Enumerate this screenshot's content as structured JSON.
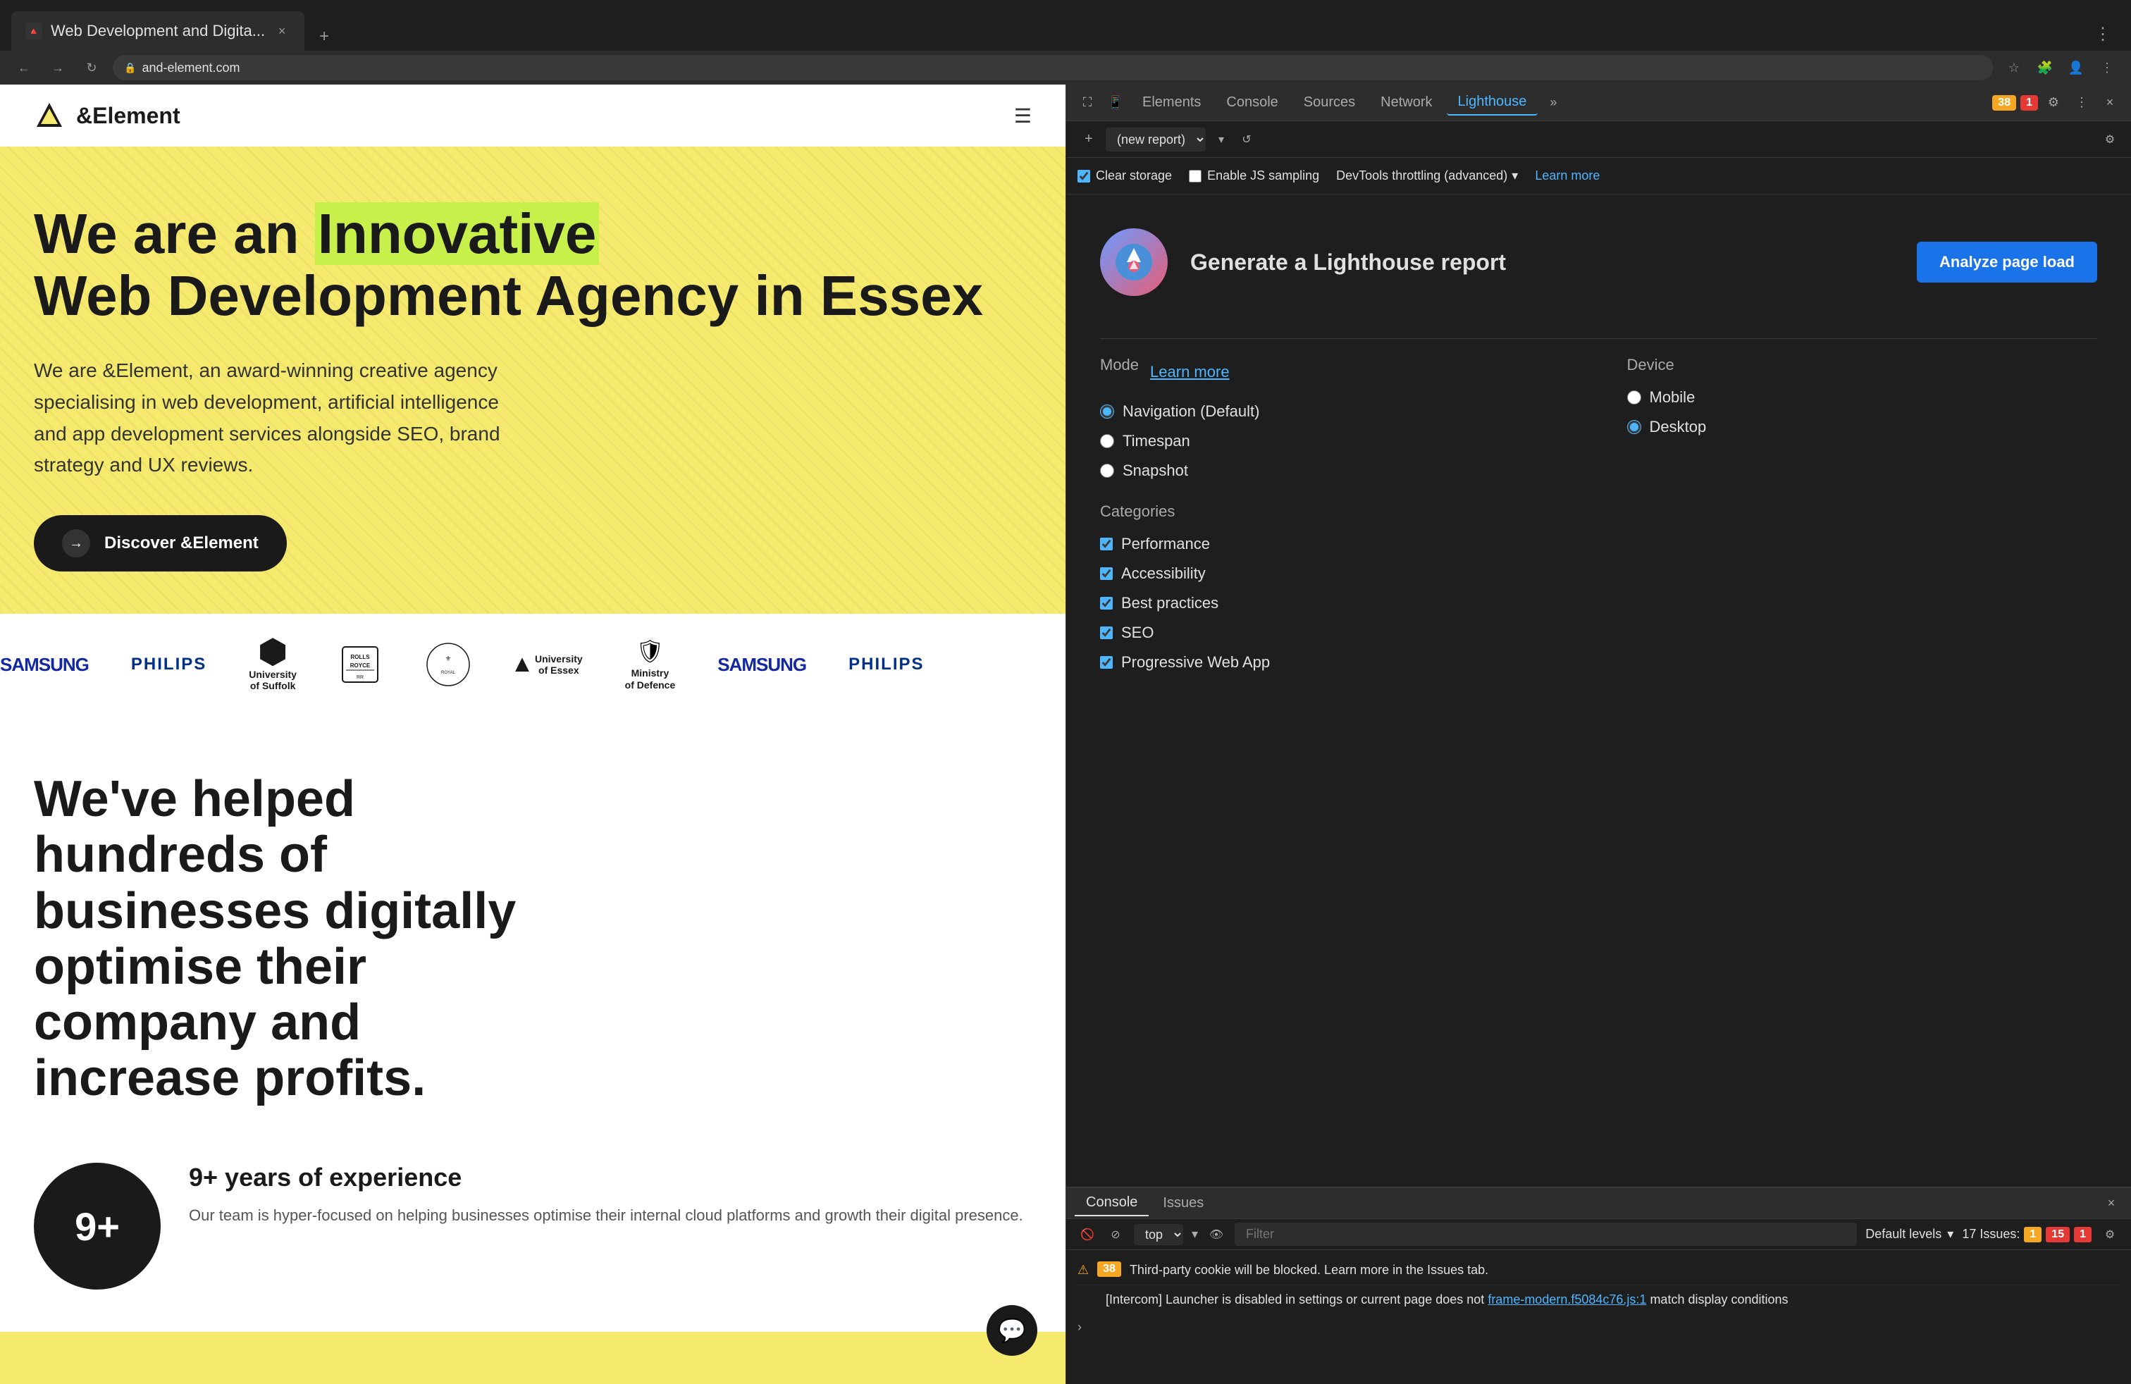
{
  "browser": {
    "tab_title": "Web Development and Digita...",
    "tab_favicon": "🔺",
    "new_tab_label": "+",
    "nav_back_icon": "←",
    "nav_forward_icon": "→",
    "nav_refresh_icon": "↻",
    "address_lock_icon": "🔒",
    "address_url": "and-element.com",
    "bookmark_icon": "☆",
    "profile_icon": "👤",
    "extensions_icon": "🧩",
    "tab_close_icon": "×",
    "extra_icon": "⋮"
  },
  "website": {
    "logo_text": "&Element",
    "hero_headline_part1": "We are an ",
    "hero_headline_highlight": "Innovative",
    "hero_headline_part2": "Web Development Agency in Essex",
    "hero_subtitle": "We are &Element, an award-winning creative agency specialising in web development, artificial intelligence and app development services alongside SEO, brand strategy and UX reviews.",
    "hero_cta": "Discover &Element",
    "hero_cta_arrow": "→",
    "logos": [
      {
        "name": "Samsung",
        "type": "samsung"
      },
      {
        "name": "PHILIPS",
        "type": "philips"
      },
      {
        "name": "University of Suffolk",
        "type": "uni-suffolk"
      },
      {
        "name": "Rolls-Royce",
        "type": "rolls-royce"
      },
      {
        "name": "Royal Warrant",
        "type": "royal"
      },
      {
        "name": "University of Essex",
        "type": "uni-essex"
      },
      {
        "name": "Ministry of Defence",
        "type": "mod"
      },
      {
        "name": "Samsung",
        "type": "samsung2"
      },
      {
        "name": "PHILIPS",
        "type": "philips2"
      }
    ],
    "content_headline": "We've helped hundreds of businesses digitally optimise their company and increase profits.",
    "stat_number": "9+",
    "stat_title": "9+ years of experience",
    "stat_desc": "Our team is hyper-focused on helping businesses optimise their internal cloud platforms and growth their digital presence."
  },
  "devtools": {
    "tabs": [
      "Elements",
      "Console",
      "Sources",
      "Network",
      "Lighthouse"
    ],
    "active_tab": "Lighthouse",
    "more_tabs_icon": "»",
    "warning_count": "38",
    "error_count": "1",
    "settings_icon": "⚙",
    "more_icon": "⋮",
    "close_icon": "×",
    "inspect_icon": "⛶",
    "device_icon": "📱"
  },
  "lighthouse": {
    "title": "Lighthouse",
    "toolbar": {
      "add_icon": "+",
      "report_placeholder": "(new report)",
      "dropdown_icon": "▾",
      "refresh_icon": "↺",
      "settings_icon": "⚙"
    },
    "options": {
      "clear_storage_label": "Clear storage",
      "enable_js_label": "Enable JS sampling",
      "throttle_label": "DevTools throttling (advanced)",
      "throttle_dropdown": "▾",
      "learn_more": "Learn more"
    },
    "generate": {
      "icon": "🔴",
      "title": "Generate a Lighthouse report",
      "analyze_btn": "Analyze page load"
    },
    "mode": {
      "label": "Mode",
      "learn_more": "Learn more",
      "options": [
        {
          "label": "Navigation (Default)",
          "selected": true
        },
        {
          "label": "Timespan",
          "selected": false
        },
        {
          "label": "Snapshot",
          "selected": false
        }
      ]
    },
    "device": {
      "label": "Device",
      "options": [
        {
          "label": "Mobile",
          "selected": false
        },
        {
          "label": "Desktop",
          "selected": true
        }
      ]
    },
    "categories": {
      "label": "Categories",
      "items": [
        {
          "label": "Performance",
          "checked": true
        },
        {
          "label": "Accessibility",
          "checked": true
        },
        {
          "label": "Best practices",
          "checked": true
        },
        {
          "label": "SEO",
          "checked": true
        },
        {
          "label": "Progressive Web App",
          "checked": true
        }
      ]
    }
  },
  "console": {
    "tabs": [
      {
        "label": "Console",
        "active": true
      },
      {
        "label": "Issues",
        "active": false
      }
    ],
    "toolbar": {
      "clear_icon": "🚫",
      "filter_icon": "⊘",
      "context_label": "top",
      "context_dropdown": "▾",
      "eye_icon": "👁",
      "filter_placeholder": "Filter",
      "default_levels": "Default levels",
      "dropdown_icon": "▾",
      "issues_label": "17 Issues:",
      "warning_badge": "1",
      "error_badge": "15",
      "error2_badge": "1",
      "settings_icon": "⚙"
    },
    "messages": [
      {
        "type": "warning",
        "badge": "38",
        "text": "Third-party cookie will be blocked. Learn more in the Issues tab.",
        "link": null
      },
      {
        "type": "info",
        "text": "[Intercom] Launcher is disabled in settings or current page does not ",
        "link": "frame-modern.f5084c76.js:1",
        "text2": "match display conditions"
      }
    ],
    "prompt_icon": "›"
  }
}
